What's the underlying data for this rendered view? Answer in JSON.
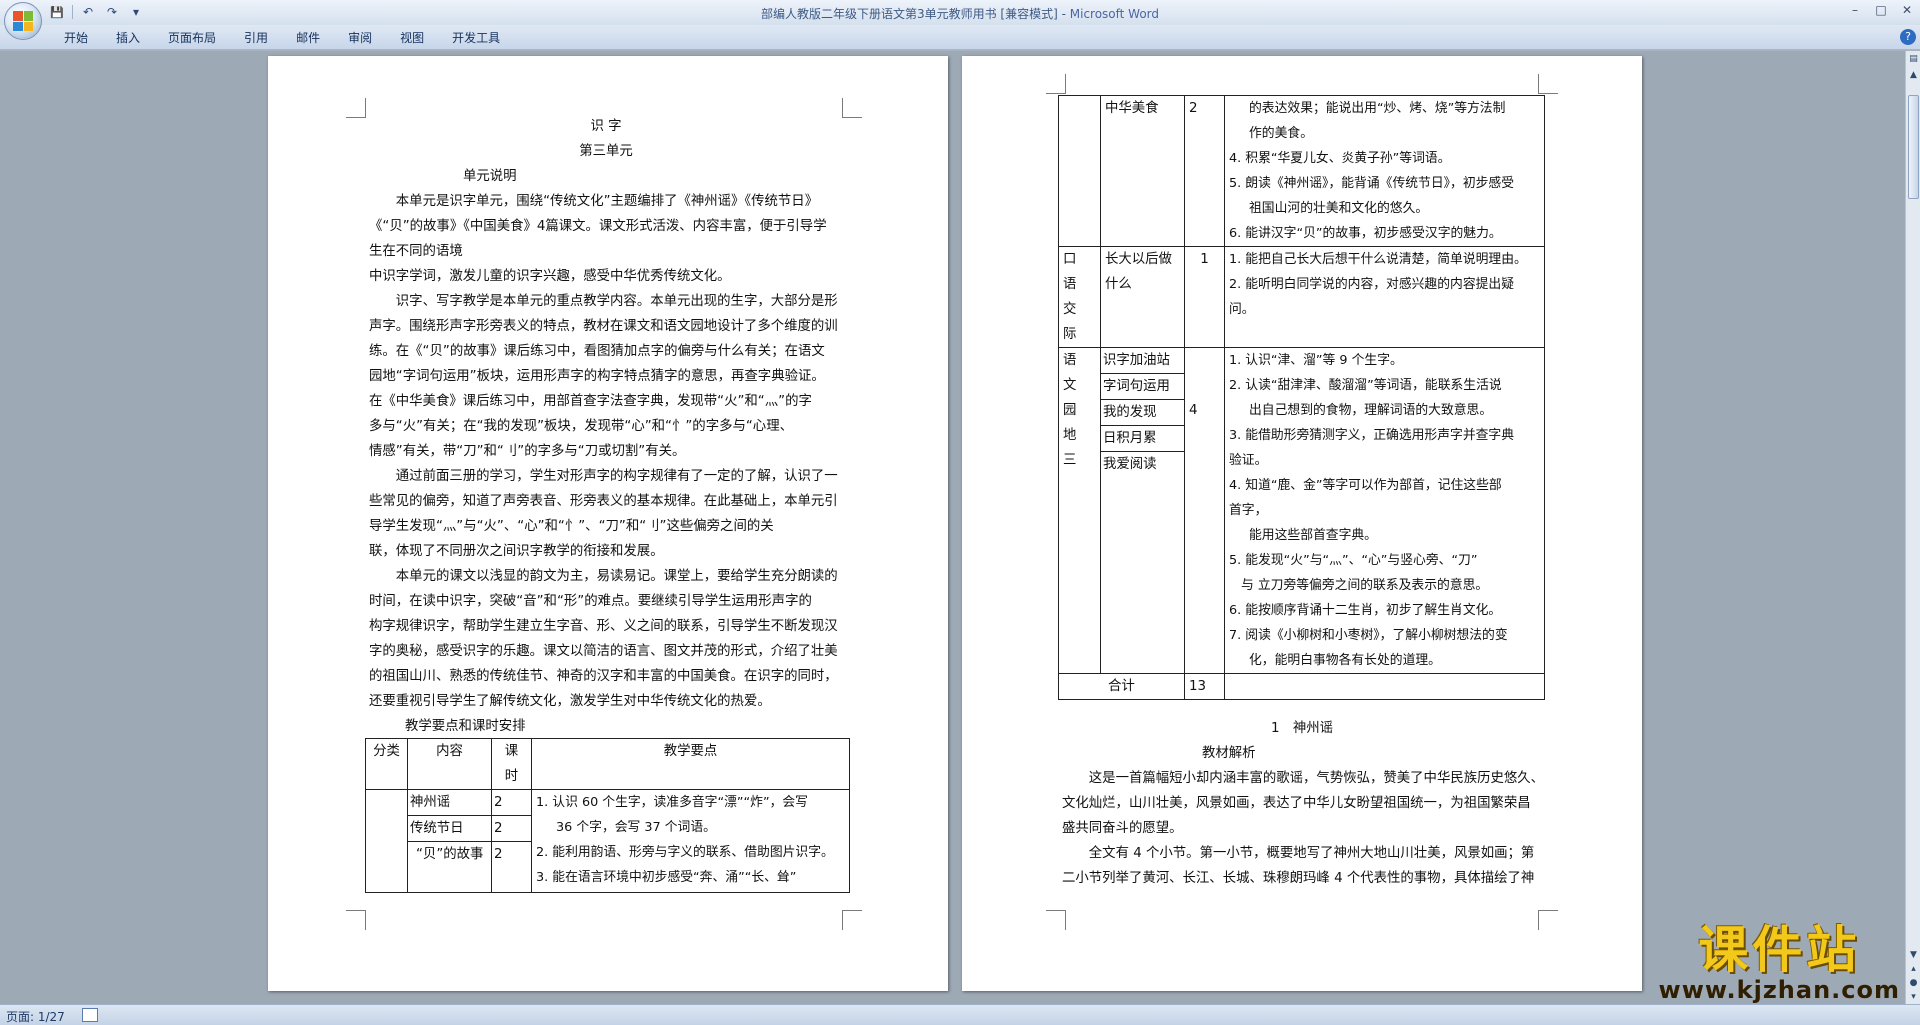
{
  "window": {
    "title": "部编人教版二年级下册语文第3单元教师用书 [兼容模式]",
    "app_name": "Microsoft Word",
    "min_label": "–",
    "max_label": "□",
    "close_label": "✕"
  },
  "qat": {
    "save": "💾",
    "undo": "↶",
    "redo": "↷",
    "customize": "▾"
  },
  "ribbon": {
    "tabs": [
      "开始",
      "插入",
      "页面布局",
      "引用",
      "邮件",
      "审阅",
      "视图",
      "开发工具"
    ],
    "help": "?"
  },
  "page1": {
    "heading1": "识 字",
    "heading2": "第三单元",
    "heading3": "单元说明",
    "paragraphs": [
      "本单元是识字单元，围绕“传统文化”主题编排了《神州谣》《传统节日》",
      "《“贝”的故事》《中国美食》4篇课文。课文形式活泼、内容丰富，便于引导学",
      "生在不同的语境",
      "中识字学词，激发儿童的识字兴趣，感受中华优秀传统文化。",
      "识字、写字教学是本单元的重点教学内容。本单元出现的生字，大部分是形",
      "声字。围绕形声字形旁表义的特点，教材在课文和语文园地设计了多个维度的训",
      "练。在《“贝”的故事》课后练习中，看图猜加点字的偏旁与什么有关；在语文",
      "园地“字词句运用”板块，运用形声字的构字特点猜字的意思，再查字典验证。",
      "在《中华美食》课后练习中，用部首查字法查字典，发现带“火”和“灬”的字",
      "多与“火”有关；在“我的发现”板块，发现带“心”和“忄”的字多与“心理、",
      "情感”有关，带“刀”和“刂”的字多与“刀或切割”有关。",
      "通过前面三册的学习，学生对形声字的构字规律有了一定的了解，认识了一",
      "些常见的偏旁，知道了声旁表音、形旁表义的基本规律。在此基础上，本单元引",
      "导学生发现“灬”与“火”、“心”和“忄”、“刀”和“刂”这些偏旁之间的关",
      "联，体现了不同册次之间识字教学的衔接和发展。",
      "本单元的课文以浅显的韵文为主，易读易记。课堂上，要给学生充分朗读的",
      "时间，在读中识字，突破“音”和“形”的难点。要继续引导学生运用形声字的",
      "构字规律识字，帮助学生建立生字音、形、义之间的联系，引导学生不断发现汉",
      "字的奥秘，感受识字的乐趣。课文以简洁的语言、图文并茂的形式，介绍了壮美",
      "的祖国山川、熟悉的传统佳节、神奇的汉字和丰富的中国美食。在识字的同时，",
      "还要重视引导学生了解传统文化，激发学生对中华传统文化的热爱。"
    ],
    "table_title": "教学要点和课时安排",
    "table_headers": [
      "分类",
      "内容",
      "课时",
      "教学要点"
    ],
    "table_rows": [
      {
        "content": "神州谣",
        "hours": "2"
      },
      {
        "content": "传统节日",
        "hours": "2"
      },
      {
        "content": "“贝”的故事",
        "hours": "2"
      }
    ],
    "table_points": [
      "1. 认识 60 个生字，读准多音字“漂”“炸”，会写",
      "36 个字，会写 37 个词语。",
      "2. 能利用韵语、形旁与字义的联系、借助图片识字。",
      "3. 能在语言环境中初步感受“奔、涌”“长、耸”"
    ]
  },
  "page2": {
    "row1": {
      "content": "中华美食",
      "hours": "2",
      "points": [
        "的表达效果；能说出用“炒、烤、烧”等方法制",
        "作的美食。",
        "4. 积累“华夏儿女、炎黄子孙”等词语。",
        "5. 朗读《神州谣》，能背诵《传统节日》，初步感受",
        "祖国山河的壮美和文化的悠久。",
        "6. 能讲汉字“贝”的故事，初步感受汉字的魅力。"
      ]
    },
    "row2": {
      "category": "口语交际",
      "content": "长大以后做什么",
      "hours": "1",
      "points": [
        "1. 能把自己长大后想干什么说清楚，简单说明理由。",
        "2. 能听明白同学说的内容，对感兴趣的内容提出疑",
        "问。"
      ]
    },
    "row3": {
      "category": "语文园地三",
      "contents": [
        "识字加油站",
        "字词句运用",
        "我的发现",
        "日积月累",
        "我爱阅读"
      ],
      "hours": "4",
      "points": [
        "1. 认识“津、溜”等 9 个生字。",
        "2. 认读“甜津津、酸溜溜”等词语，能联系生活说",
        "出自己想到的食物，理解词语的大致意思。",
        "3. 能借助形旁猜测字义，正确选用形声字并查字典",
        "验证。",
        "4. 知道“鹿、金”等字可以作为部首，记住这些部",
        "首字，",
        "能用这些部首查字典。",
        "5. 能发现“火”与“灬”、“心”与竖心旁、“刀”",
        "与 立刀旁等偏旁之间的联系及表示的意思。",
        "6. 能按顺序背诵十二生肖，初步了解生肖文化。",
        "7. 阅读《小柳树和小枣树》，了解小柳树想法的变",
        "化，能明白事物各有长处的道理。"
      ]
    },
    "total": {
      "label": "合计",
      "hours": "13"
    },
    "lesson_title": "1　神州谣",
    "analysis_title": "教材解析",
    "paragraphs": [
      "这是一首篇幅短小却内涵丰富的歌谣，气势恢弘，赞美了中华民族历史悠久、",
      "文化灿烂，山川壮美，风景如画，表达了中华儿女盼望祖国统一，为祖国繁荣昌",
      "盛共同奋斗的愿望。",
      "全文有 4 个小节。第一小节，概要地写了神州大地山川壮美，风景如画；第",
      "二小节列举了黄河、长江、长城、珠穆朗玛峰 4 个代表性的事物，具体描绘了神"
    ]
  },
  "status": {
    "page": "页面: 1/27"
  },
  "watermark": {
    "line1": "课件站",
    "line2": "www.kjzhan.com"
  },
  "colors": {
    "accent": "#4a66a8",
    "workspace": "#9ea9b6",
    "watermark": "#f2c81a"
  }
}
